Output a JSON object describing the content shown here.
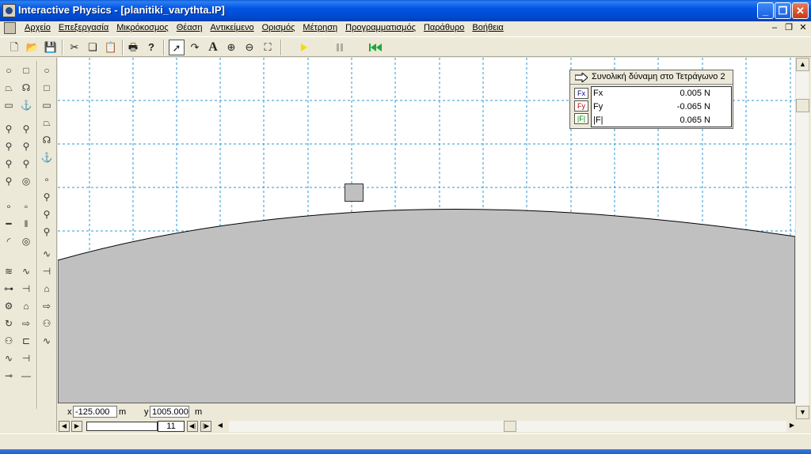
{
  "window": {
    "title": "Interactive Physics - [planitiki_varythta.IP]",
    "min_glyph": "_",
    "max_glyph": "❐",
    "close_glyph": "✕"
  },
  "menu": {
    "items": [
      {
        "label": "Αρχείο"
      },
      {
        "label": "Επεξεργασία"
      },
      {
        "label": "Μικρόκοσμος"
      },
      {
        "label": "Θέαση"
      },
      {
        "label": "Αντικείμενο"
      },
      {
        "label": "Ορισμός"
      },
      {
        "label": "Μέτρηση"
      },
      {
        "label": "Προγραμματισμός"
      },
      {
        "label": "Παράθυρο"
      },
      {
        "label": "Βοήθεια"
      }
    ],
    "mdi_min": "–",
    "mdi_restore": "❐",
    "mdi_close": "✕"
  },
  "toolbar": {
    "icons": [
      "new-icon",
      "open-icon",
      "save-icon",
      "cut-icon",
      "copy-icon",
      "paste-icon",
      "print-icon",
      "help-icon",
      "pointer-icon",
      "rotate-icon",
      "text-icon",
      "zoom-in-icon",
      "zoom-out-icon",
      "zoom-fit-icon",
      "run-icon",
      "stop-icon",
      "reset-icon"
    ],
    "text_tool": "A",
    "help_glyph": "?"
  },
  "meter": {
    "title": "Συνολική δύναμη στο Τετράγωνο 2",
    "tags": [
      "Fx",
      "Fy",
      "|F|"
    ],
    "colors": {
      "fx": "#000080",
      "fy": "#c00000",
      "f": "#008000"
    },
    "rows": [
      {
        "label": "Fx",
        "value": "0.005 N"
      },
      {
        "label": "Fy",
        "value": "-0.065 N"
      },
      {
        "label": "|F|",
        "value": "0.065 N"
      }
    ]
  },
  "coords": {
    "x_label": "x",
    "x_value": "-125.000",
    "x_unit": "m",
    "y_label": "y",
    "y_value": "1005.000",
    "y_unit": "m"
  },
  "frames": {
    "current": "11"
  },
  "colors": {
    "grid": "#2a9ad6",
    "terrain": "#c0c0c0",
    "title_bar": "#0055e5"
  }
}
